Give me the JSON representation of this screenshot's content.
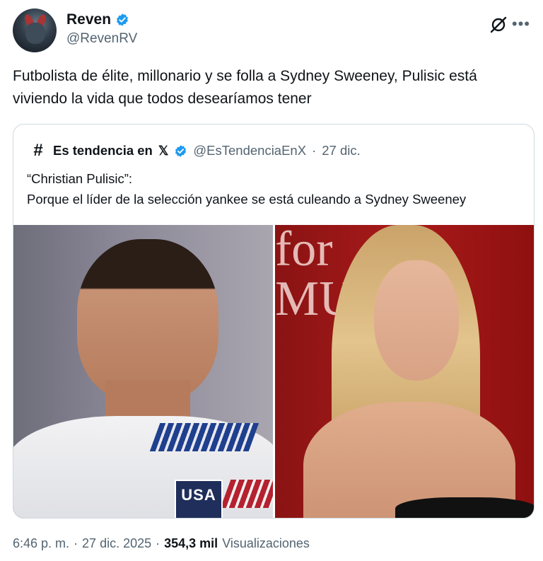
{
  "author": {
    "name": "Reven",
    "handle": "@RevenRV",
    "verified_color": "#1d9bf0"
  },
  "tweet": {
    "text": "Futbolista de élite, millonario y se folla a Sydney Sweeney, Pulisic está viviendo la vida que todos desearíamos tener"
  },
  "quoted": {
    "name": "Es tendencia en",
    "x_glyph": "𝕏",
    "handle": "@EsTendenciaEnX",
    "separator": "·",
    "date": "27 dic.",
    "text_line1": "“Christian Pulisic”:",
    "text_line2": "Porque el líder de la selección yankee se está culeando a Sydney Sweeney",
    "media": {
      "left_badge_text": "USA",
      "right_sign_text": "for\nMU"
    }
  },
  "footer": {
    "time": "6:46 p. m.",
    "sep1": "·",
    "date": "27 dic. 2025",
    "sep2": "·",
    "views_count": "354,3 mil",
    "views_label": "Visualizaciones"
  },
  "icons": {
    "grok": "grok-icon",
    "more": "more-icon",
    "hash": "hashtag-icon"
  },
  "colors": {
    "text": "#0f1419",
    "secondary": "#536471",
    "border": "#cfd9de",
    "verified": "#1d9bf0"
  }
}
